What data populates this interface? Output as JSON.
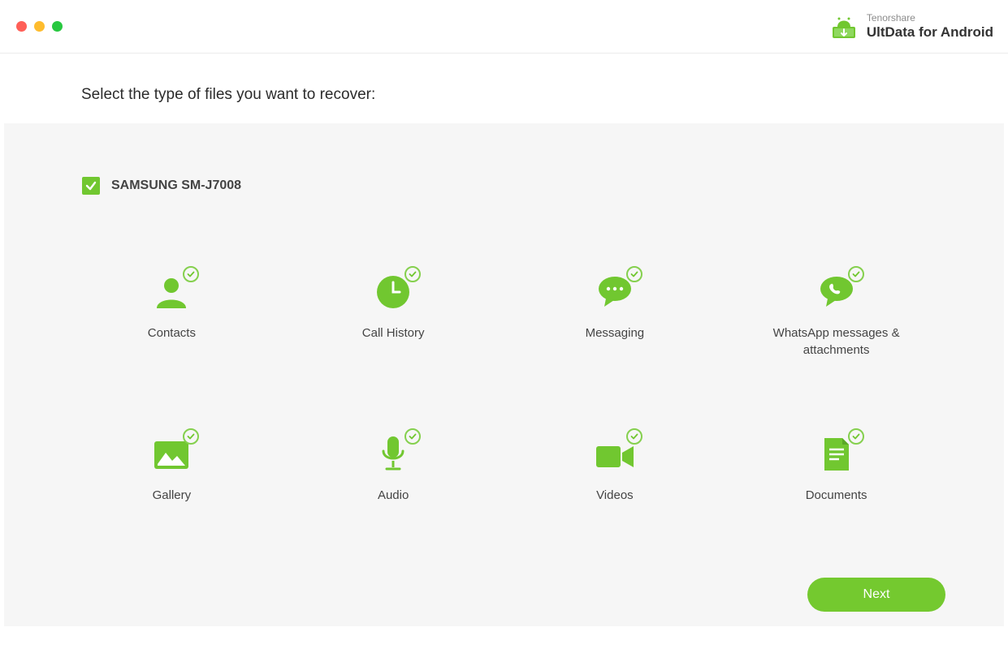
{
  "brand": {
    "company": "Tenorshare",
    "product": "UltData for Android"
  },
  "heading": "Select the type of files you want to recover:",
  "device_label": "SAMSUNG SM-J7008",
  "tiles": [
    {
      "label": "Contacts",
      "icon": "contacts"
    },
    {
      "label": "Call History",
      "icon": "call-history"
    },
    {
      "label": "Messaging",
      "icon": "messaging"
    },
    {
      "label": "WhatsApp messages & attachments",
      "icon": "whatsapp"
    },
    {
      "label": "Gallery",
      "icon": "gallery"
    },
    {
      "label": "Audio",
      "icon": "audio"
    },
    {
      "label": "Videos",
      "icon": "videos"
    },
    {
      "label": "Documents",
      "icon": "documents"
    }
  ],
  "next_label": "Next",
  "colors": {
    "accent": "#74c92f"
  }
}
